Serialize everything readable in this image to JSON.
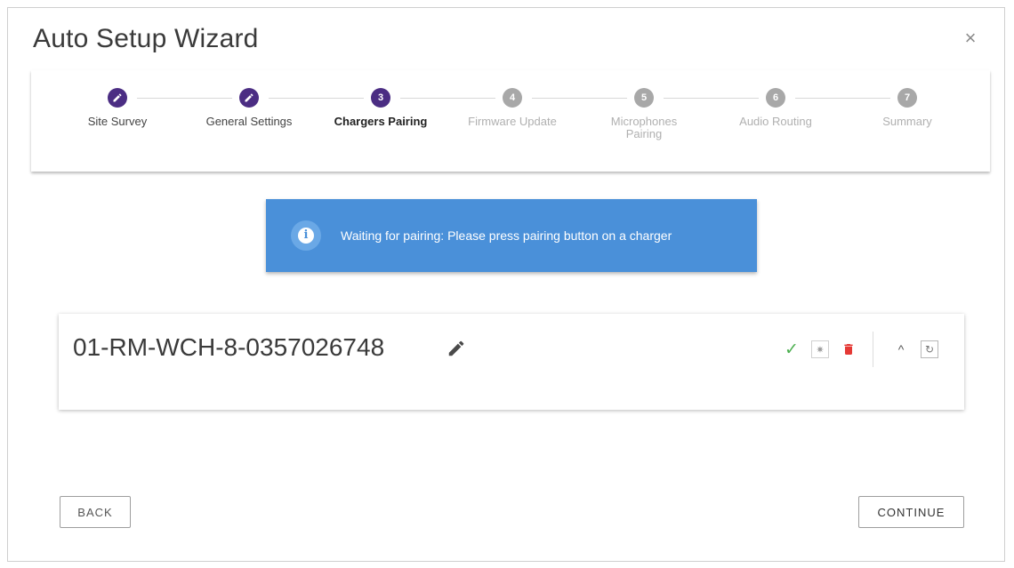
{
  "dialog": {
    "title": "Auto Setup Wizard",
    "close_glyph": "×"
  },
  "stepper": {
    "steps": [
      {
        "index": "1",
        "label": "Site Survey",
        "status": "done",
        "icon": "pencil-icon"
      },
      {
        "index": "2",
        "label": "General Settings",
        "status": "done",
        "icon": "pencil-icon"
      },
      {
        "index": "3",
        "label": "Chargers Pairing",
        "status": "active"
      },
      {
        "index": "4",
        "label": "Firmware Update",
        "status": "pending"
      },
      {
        "index": "5",
        "label": "Microphones Pairing",
        "status": "pending"
      },
      {
        "index": "6",
        "label": "Audio Routing",
        "status": "pending"
      },
      {
        "index": "7",
        "label": "Summary",
        "status": "pending"
      }
    ],
    "accent_color": "#4b2d83",
    "pending_color": "#a8a8a8"
  },
  "banner": {
    "text": "Waiting for pairing: Please press pairing button on a charger",
    "icon": "info-icon",
    "color": "#4a90d9"
  },
  "device": {
    "name": "01-RM-WCH-8-0357026748",
    "status_icon": "check-icon",
    "status_color": "#4caf50",
    "delete_color": "#e53935"
  },
  "footer": {
    "back_label": "BACK",
    "continue_label": "CONTINUE"
  }
}
